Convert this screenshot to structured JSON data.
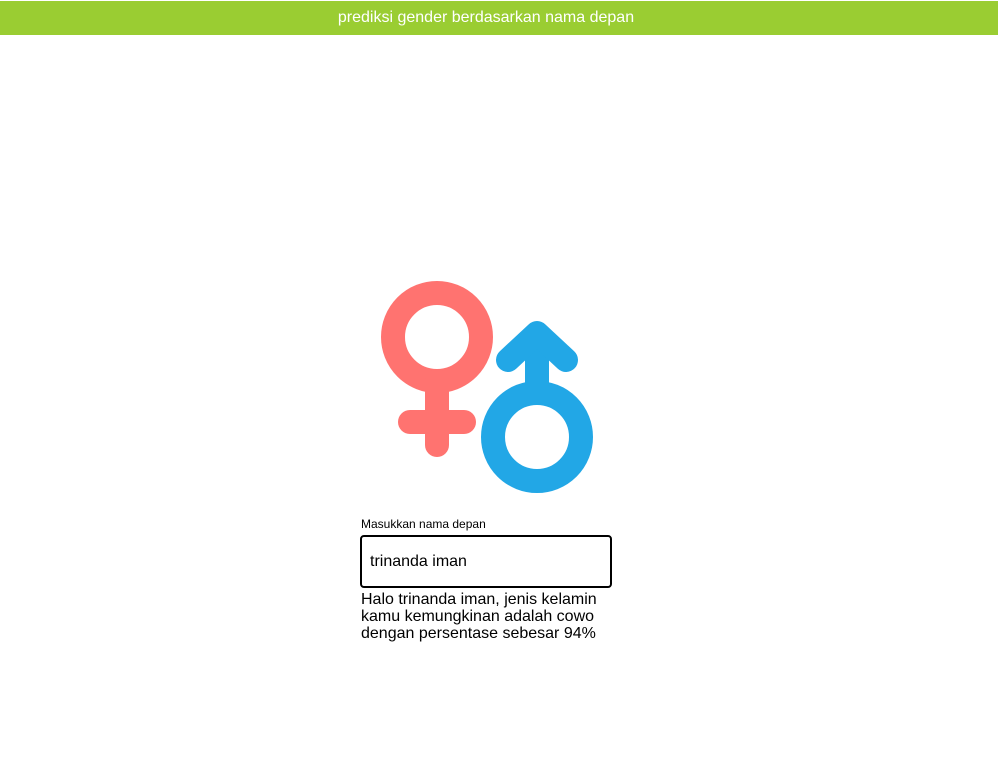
{
  "header": {
    "title": "prediksi gender berdasarkan nama depan"
  },
  "logo": {
    "icon": "gender-symbols-icon",
    "female_color": "#ff7370",
    "male_color": "#22a7e6"
  },
  "form": {
    "label": "Masukkan nama depan",
    "input_value": "trinanda iman"
  },
  "result": {
    "text": "Halo trinanda iman, jenis kelamin kamu kemungkinan adalah cowo dengan persentase sebesar 94%"
  },
  "colors": {
    "header_background": "#9acd32",
    "header_text": "#ffffff"
  }
}
